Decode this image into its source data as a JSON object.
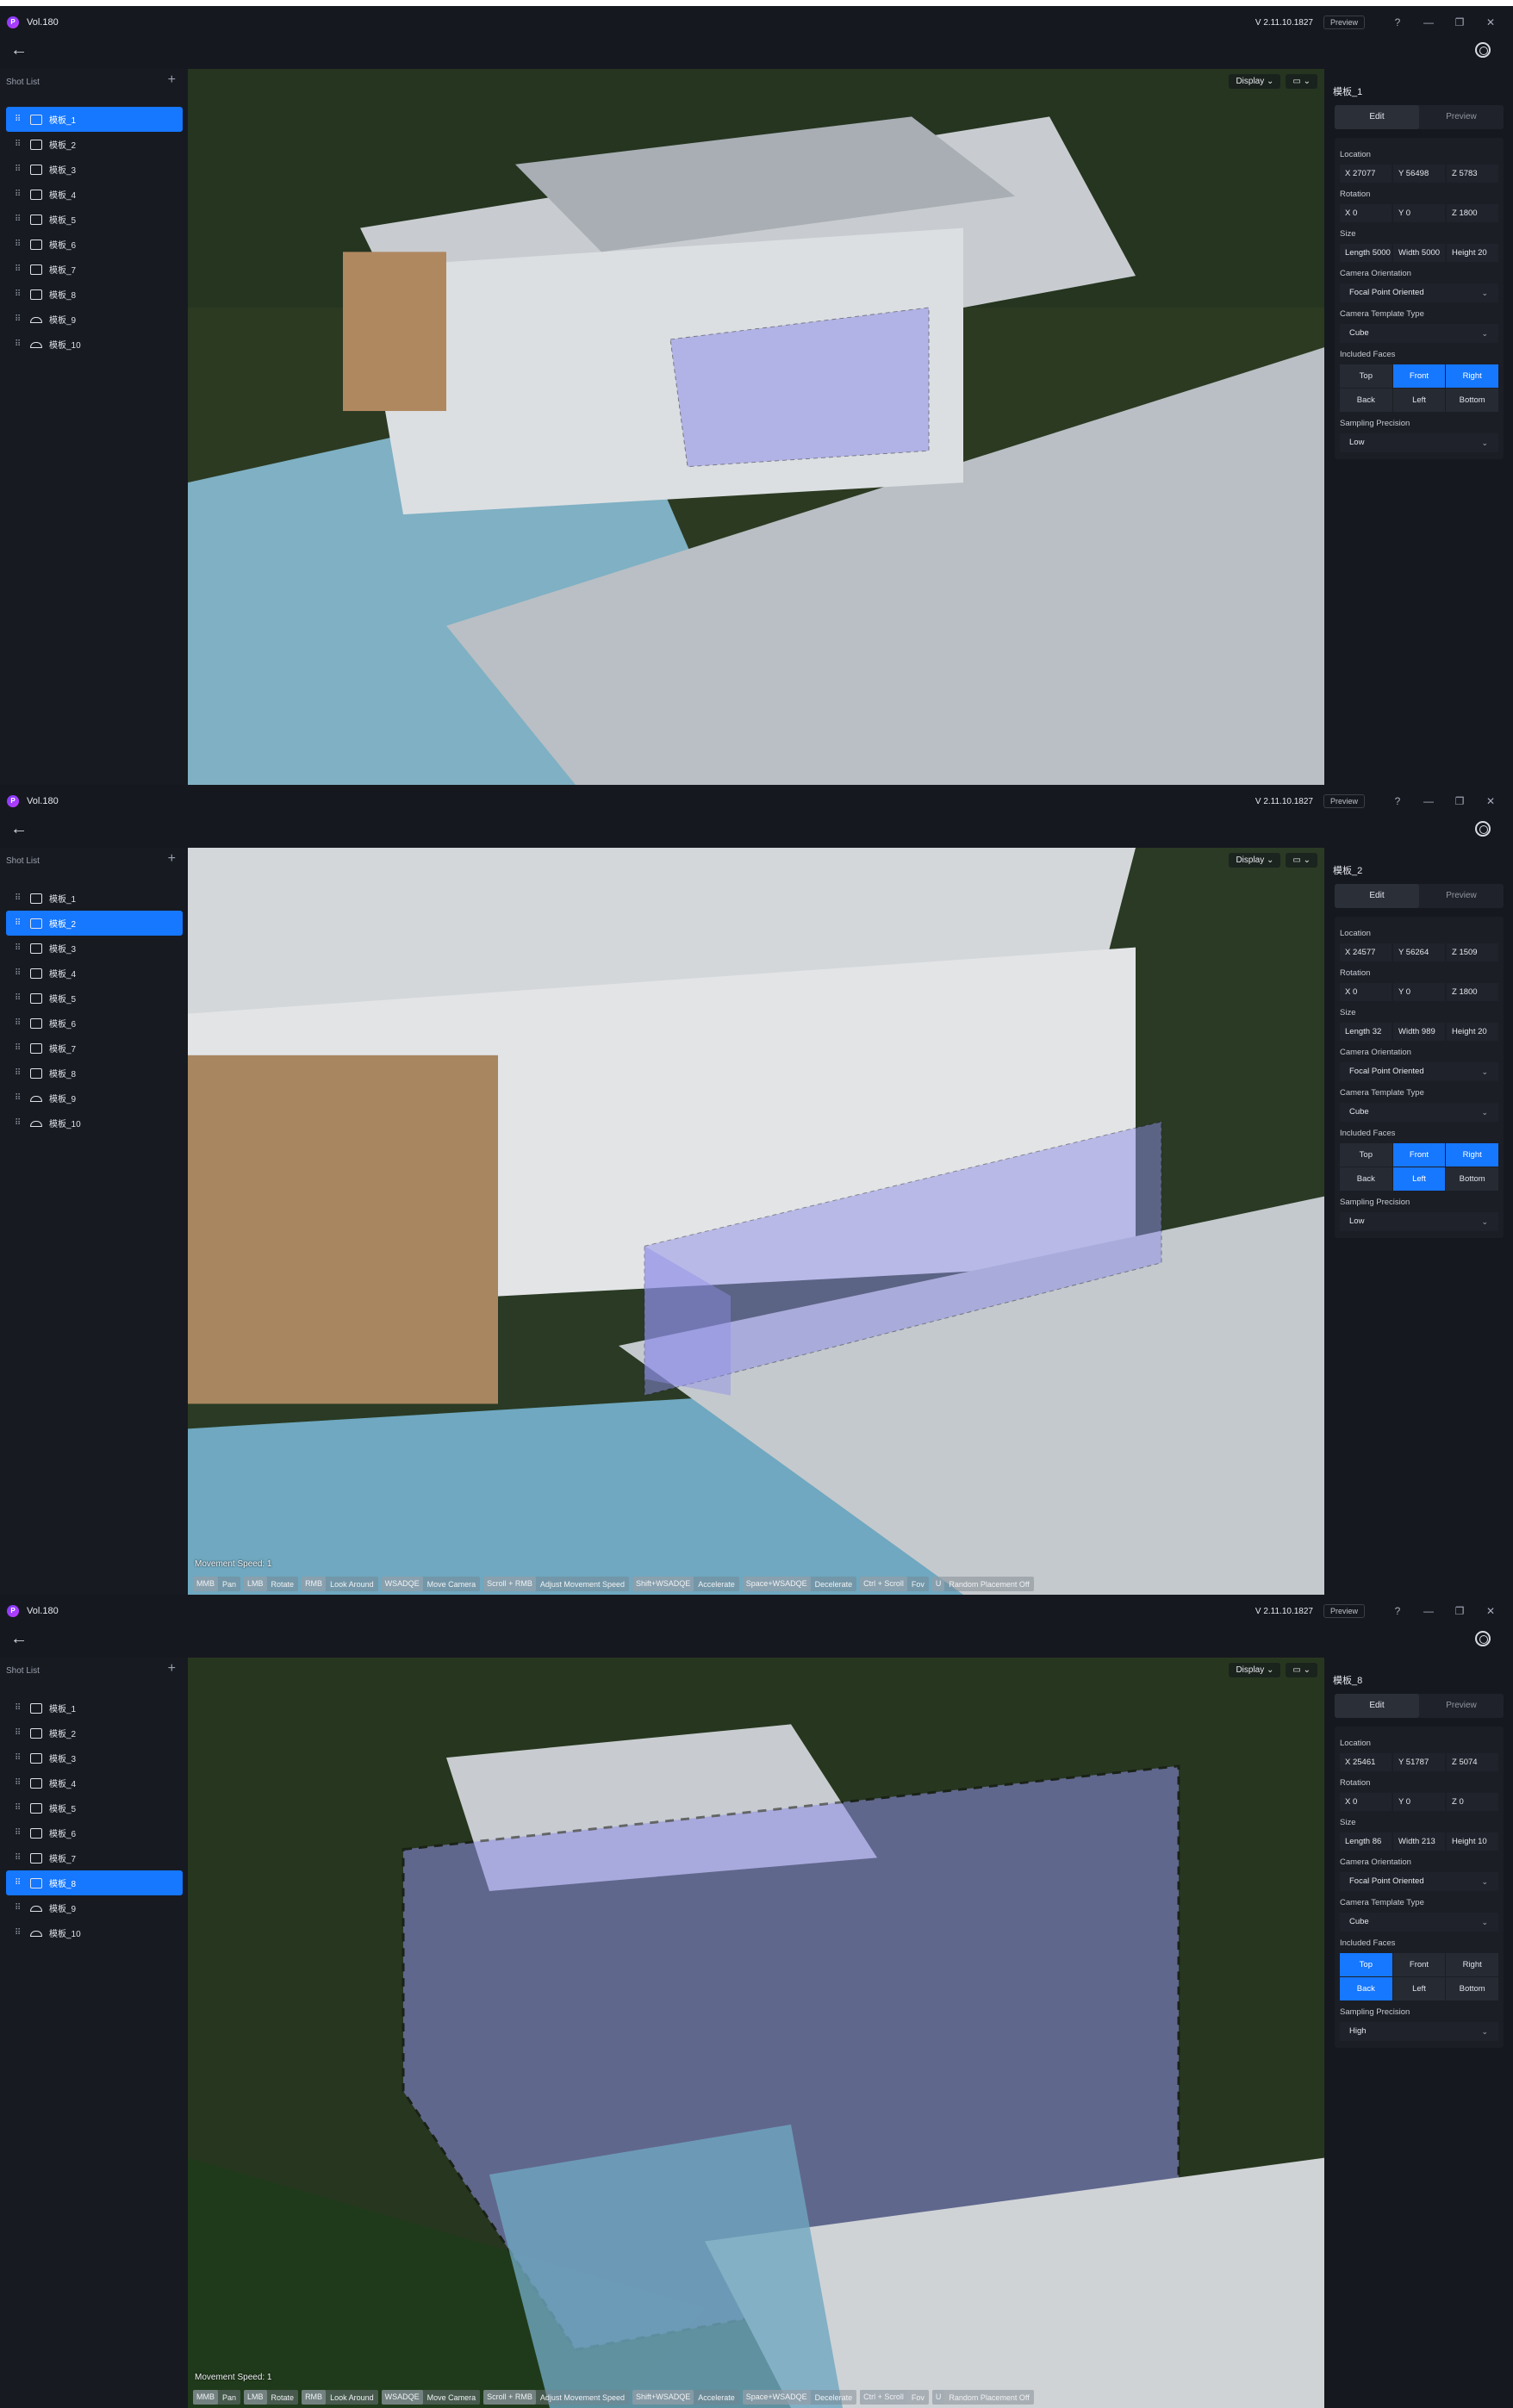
{
  "app": {
    "title": "Vol.180",
    "version": "V 2.11.10.1827",
    "preview_badge": "Preview",
    "logo_letter": "P"
  },
  "labels": {
    "shot_list": "Shot List",
    "add": "+",
    "back": "←",
    "display": "Display ⌄",
    "cam_tool": "▭ ⌄",
    "edit": "Edit",
    "preview": "Preview",
    "location": "Location",
    "rotation": "Rotation",
    "size": "Size",
    "camera_orientation": "Camera Orientation",
    "camera_template_type": "Camera Template Type",
    "included_faces": "Included Faces",
    "sampling_precision": "Sampling Precision",
    "chevron": "⌄",
    "minimize": "—",
    "restore": "❐",
    "close": "✕",
    "help": "?",
    "movement_speed": "Movement Speed: 1"
  },
  "shots": [
    {
      "label": "模板_1",
      "icon": "cube-icon"
    },
    {
      "label": "模板_2",
      "icon": "cube-icon"
    },
    {
      "label": "模板_3",
      "icon": "cube-icon"
    },
    {
      "label": "模板_4",
      "icon": "cube-icon"
    },
    {
      "label": "模板_5",
      "icon": "cube-icon"
    },
    {
      "label": "模板_6",
      "icon": "cube-icon"
    },
    {
      "label": "模板_7",
      "icon": "cube-icon"
    },
    {
      "label": "模板_8",
      "icon": "cube-icon"
    },
    {
      "label": "模板_9",
      "icon": "hemisphere-icon"
    },
    {
      "label": "模板_10",
      "icon": "hemisphere-icon"
    }
  ],
  "face_names": [
    "Top",
    "Front",
    "Right",
    "Back",
    "Left",
    "Bottom"
  ],
  "hints": [
    {
      "key": "MMB",
      "action": "Pan"
    },
    {
      "key": "LMB",
      "action": "Rotate"
    },
    {
      "key": "RMB",
      "action": "Look Around"
    },
    {
      "key": "WSADQE",
      "action": "Move Camera"
    },
    {
      "key": "Scroll + RMB",
      "action": "Adjust Movement Speed"
    },
    {
      "key": "Shift+WSADQE",
      "action": "Accelerate"
    },
    {
      "key": "Space+WSADQE",
      "action": "Decelerate"
    },
    {
      "key": "Ctrl + Scroll",
      "action": "Fov"
    },
    {
      "key": "U",
      "action": "Random Placement Off"
    }
  ],
  "screens": [
    {
      "active_shot": 0,
      "title": "模板_1",
      "location": [
        "X  27077",
        "Y  56498",
        "Z  5783"
      ],
      "rotation": [
        "X  0",
        "Y  0",
        "Z  1800"
      ],
      "size": [
        "Length  5000",
        "Width  5000",
        "Height  20"
      ],
      "orientation": "Focal Point Oriented",
      "template_type": "Cube",
      "faces_on": [
        false,
        true,
        true,
        false,
        false,
        false
      ],
      "precision": "Low",
      "show_hints": false
    },
    {
      "active_shot": 1,
      "title": "模板_2",
      "location": [
        "X  24577",
        "Y  56264",
        "Z  1509"
      ],
      "rotation": [
        "X  0",
        "Y  0",
        "Z  1800"
      ],
      "size": [
        "Length  32",
        "Width  989",
        "Height  20"
      ],
      "orientation": "Focal Point Oriented",
      "template_type": "Cube",
      "faces_on": [
        false,
        true,
        true,
        false,
        true,
        false
      ],
      "precision": "Low",
      "show_hints": true
    },
    {
      "active_shot": 7,
      "title": "模板_8",
      "location": [
        "X  25461",
        "Y  51787",
        "Z  5074"
      ],
      "rotation": [
        "X  0",
        "Y  0",
        "Z  0"
      ],
      "size": [
        "Length  86",
        "Width  213",
        "Height  10"
      ],
      "orientation": "Focal Point Oriented",
      "template_type": "Cube",
      "faces_on": [
        true,
        false,
        false,
        true,
        false,
        false
      ],
      "precision": "High",
      "show_hints": true
    }
  ],
  "colors": {
    "accent": "#1677ff",
    "bg": "#16181f"
  }
}
